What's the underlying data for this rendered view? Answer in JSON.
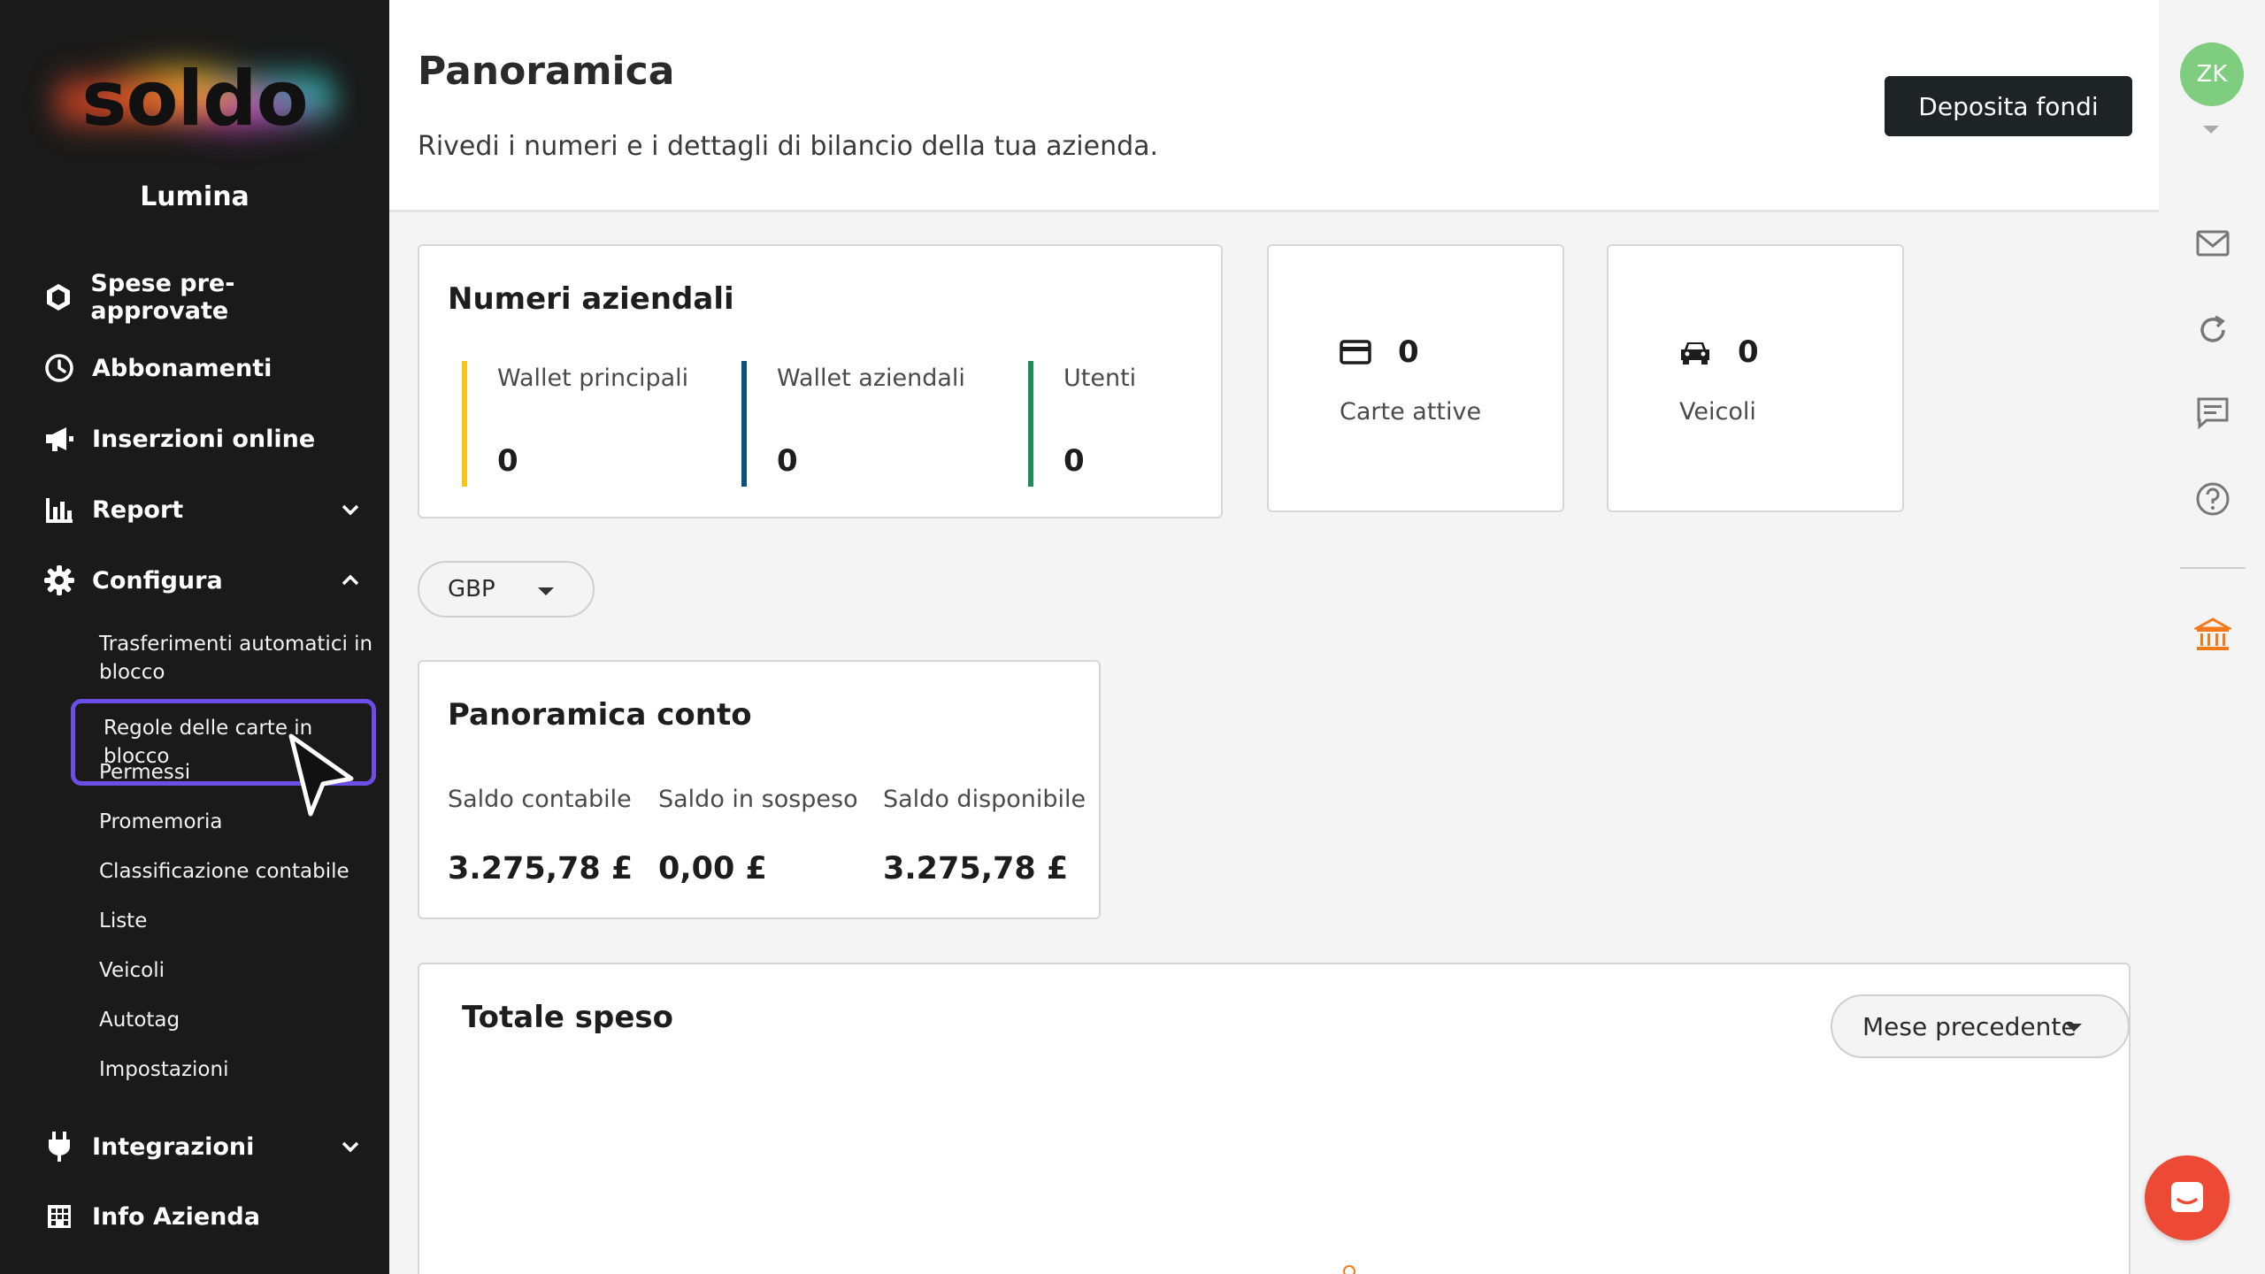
{
  "brand": {
    "logo": "soldo",
    "company": "Lumina"
  },
  "sidebar": {
    "items": [
      {
        "label": "Spese pre-approvate",
        "icon": "hexagon-icon"
      },
      {
        "label": "Abbonamenti",
        "icon": "clock-icon"
      },
      {
        "label": "Inserzioni online",
        "icon": "megaphone-icon"
      },
      {
        "label": "Report",
        "icon": "bar-chart-icon"
      },
      {
        "label": "Configura",
        "icon": "gear-icon"
      },
      {
        "label": "Integrazioni",
        "icon": "plug-icon"
      },
      {
        "label": "Info Azienda",
        "icon": "building-icon"
      }
    ],
    "configura_sub": [
      "Trasferimenti automatici in blocco",
      "Regole delle carte in blocco",
      "Permessi",
      "Promemoria",
      "Classificazione contabile",
      "Liste",
      "Veicoli",
      "Autotag",
      "Impostazioni"
    ]
  },
  "header": {
    "title": "Panoramica",
    "subtitle": "Rivedi i numeri e i dettagli di bilancio della tua azienda.",
    "deposit_label": "Deposita fondi"
  },
  "business_numbers": {
    "title": "Numeri aziendali",
    "metrics": [
      {
        "label": "Wallet principali",
        "value": "0",
        "color": "#f5c518"
      },
      {
        "label": "Wallet aziendali",
        "value": "0",
        "color": "#0b4f7a"
      },
      {
        "label": "Utenti",
        "value": "0",
        "color": "#1f8a5a"
      }
    ]
  },
  "cards_stat": {
    "value": "0",
    "label": "Carte attive"
  },
  "vehicles_stat": {
    "value": "0",
    "label": "Veicoli"
  },
  "currency": {
    "selected": "GBP"
  },
  "account_overview": {
    "title": "Panoramica conto",
    "balances": [
      {
        "label": "Saldo contabile",
        "value": "3.275,78 £"
      },
      {
        "label": "Saldo in sospeso",
        "value": "0,00 £"
      },
      {
        "label": "Saldo disponibile",
        "value": "3.275,78 £"
      }
    ]
  },
  "total_spent": {
    "title": "Totale speso",
    "period": "Mese precedente"
  },
  "user": {
    "initials": "ZK"
  },
  "colors": {
    "sidebar_bg": "#1a1a1a",
    "selection": "#6b4ee6",
    "avatar": "#7fcd7f",
    "accent_orange": "#f27a1a",
    "chat": "#ec4a34"
  }
}
